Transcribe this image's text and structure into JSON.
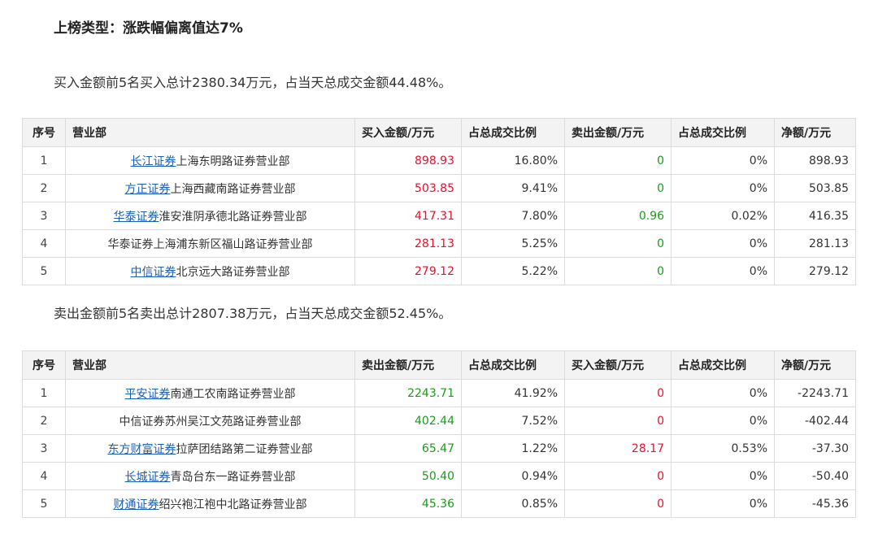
{
  "title": "上榜类型：涨跌幅偏离值达7%",
  "buy_summary": "买入金额前5名买入总计2380.34万元，占当天总成交金额44.48%。",
  "sell_summary": "卖出金额前5名卖出总计2807.38万元，占当天总成交金额52.45%。",
  "buy_table": {
    "headers": [
      "序号",
      "营业部",
      "买入金额/万元",
      "占总成交比例",
      "卖出金额/万元",
      "占总成交比例",
      "净额/万元"
    ],
    "rows": [
      {
        "idx": "1",
        "broker": "长江证券",
        "branch": "上海东明路证券营业部",
        "buy": "898.93",
        "buy_pct": "16.80%",
        "sell": "0",
        "sell_pct": "0%",
        "net": "898.93"
      },
      {
        "idx": "2",
        "broker": "方正证券",
        "branch": "上海西藏南路证券营业部",
        "buy": "503.85",
        "buy_pct": "9.41%",
        "sell": "0",
        "sell_pct": "0%",
        "net": "503.85"
      },
      {
        "idx": "3",
        "broker": "华泰证券",
        "branch": "淮安淮阴承德北路证券营业部",
        "buy": "417.31",
        "buy_pct": "7.80%",
        "sell": "0.96",
        "sell_pct": "0.02%",
        "net": "416.35"
      },
      {
        "idx": "4",
        "broker": "",
        "branch": "华泰证券上海浦东新区福山路证券营业部",
        "buy": "281.13",
        "buy_pct": "5.25%",
        "sell": "0",
        "sell_pct": "0%",
        "net": "281.13"
      },
      {
        "idx": "5",
        "broker": "中信证券",
        "branch": "北京远大路证券营业部",
        "buy": "279.12",
        "buy_pct": "5.22%",
        "sell": "0",
        "sell_pct": "0%",
        "net": "279.12"
      }
    ]
  },
  "sell_table": {
    "headers": [
      "序号",
      "营业部",
      "卖出金额/万元",
      "占总成交比例",
      "买入金额/万元",
      "占总成交比例",
      "净额/万元"
    ],
    "rows": [
      {
        "idx": "1",
        "broker": "平安证券",
        "branch": "南通工农南路证券营业部",
        "sell": "2243.71",
        "sell_pct": "41.92%",
        "buy": "0",
        "buy_pct": "0%",
        "net": "-2243.71"
      },
      {
        "idx": "2",
        "broker": "",
        "branch": "中信证券苏州吴江文苑路证券营业部",
        "sell": "402.44",
        "sell_pct": "7.52%",
        "buy": "0",
        "buy_pct": "0%",
        "net": "-402.44"
      },
      {
        "idx": "3",
        "broker": "东方财富证券",
        "branch": "拉萨团结路第二证券营业部",
        "sell": "65.47",
        "sell_pct": "1.22%",
        "buy": "28.17",
        "buy_pct": "0.53%",
        "net": "-37.30"
      },
      {
        "idx": "4",
        "broker": "长城证券",
        "branch": "青岛台东一路证券营业部",
        "sell": "50.40",
        "sell_pct": "0.94%",
        "buy": "0",
        "buy_pct": "0%",
        "net": "-50.40"
      },
      {
        "idx": "5",
        "broker": "财通证券",
        "branch": "绍兴袍江袍中北路证券营业部",
        "sell": "45.36",
        "sell_pct": "0.85%",
        "buy": "0",
        "buy_pct": "0%",
        "net": "-45.36"
      }
    ]
  },
  "colors": {
    "buy_value": "#e8112d",
    "sell_value": "#1a9c1a",
    "link": "#1a5fb4",
    "header_bg": "#f3f3f3"
  }
}
